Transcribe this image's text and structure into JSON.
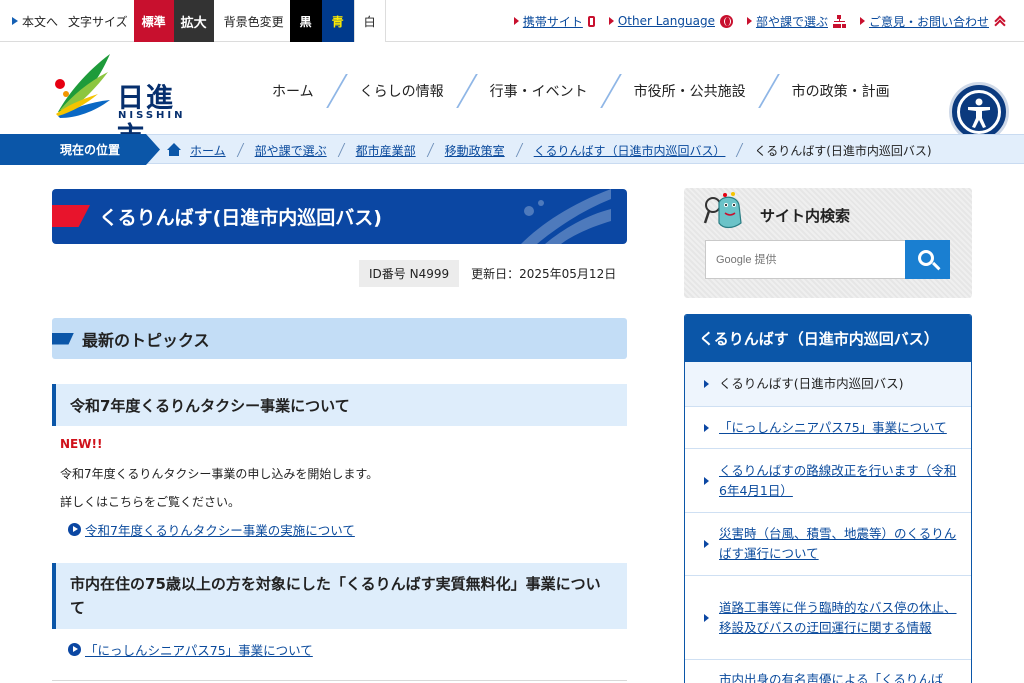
{
  "utility": {
    "skip_label": "本文へ",
    "text_size_label": "文字サイズ",
    "size_standard": "標準",
    "size_large": "拡大",
    "bg_color_label": "背景色変更",
    "bg_black": "黒",
    "bg_blue": "青",
    "bg_white": "白",
    "mobile_site": "携帯サイト",
    "other_language": "Other Language",
    "select_dept": "部や課で選ぶ",
    "contact": "ご意見・お問い合わせ"
  },
  "header": {
    "logo_text": "日進市",
    "logo_sub": "NISSHIN",
    "nav": [
      "ホーム",
      "くらしの情報",
      "行事・イベント",
      "市役所・公共施設",
      "市の政策・計画"
    ]
  },
  "breadcrumb": {
    "label": "現在の位置",
    "items": [
      "ホーム",
      "部や課で選ぶ",
      "都市産業部",
      "移動政策室",
      "くるりんばす（日進市内巡回バス）"
    ],
    "current": "くるりんばす(日進市内巡回バス)"
  },
  "page": {
    "title": "くるりんばす(日進市内巡回バス)",
    "id": "ID番号 N4999",
    "updated": "更新日：2025年05月12日"
  },
  "topics": {
    "heading": "最新のトピックス",
    "section1_title": "令和7年度くるりんタクシー事業について",
    "new_label": "NEW!!",
    "text1": "令和7年度くるりんタクシー事業の申し込みを開始します。",
    "text2": "詳しくはこちらをご覧ください。",
    "link1": "令和7年度くるりんタクシー事業の実施について",
    "section2_title": "市内在住の75歳以上の方を対象にした「くるりんばす実質無料化」事業について",
    "link2": "「にっしんシニアパス75」事業について"
  },
  "search": {
    "title": "サイト内検索",
    "placeholder": "Google 提供"
  },
  "side_nav": {
    "heading": "くるりんばす（日進市内巡回バス）",
    "items": [
      "くるりんばす(日進市内巡回バス)",
      "「にっしんシニアパス75」事業について",
      "くるりんばすの路線改正を行います（令和6年4月1日）",
      "災害時（台風、積雪、地震等）のくるりんばす運行について",
      "道路工事等に伴う臨時的なバス停の休止、移設及びバスの迂回運行に関する情報",
      "市内出身の有名声優による「くるりんば"
    ]
  },
  "colors": {
    "brand_blue": "#0b47a3",
    "accent_red": "#c8102e",
    "light_blue": "#c3ddf6"
  }
}
